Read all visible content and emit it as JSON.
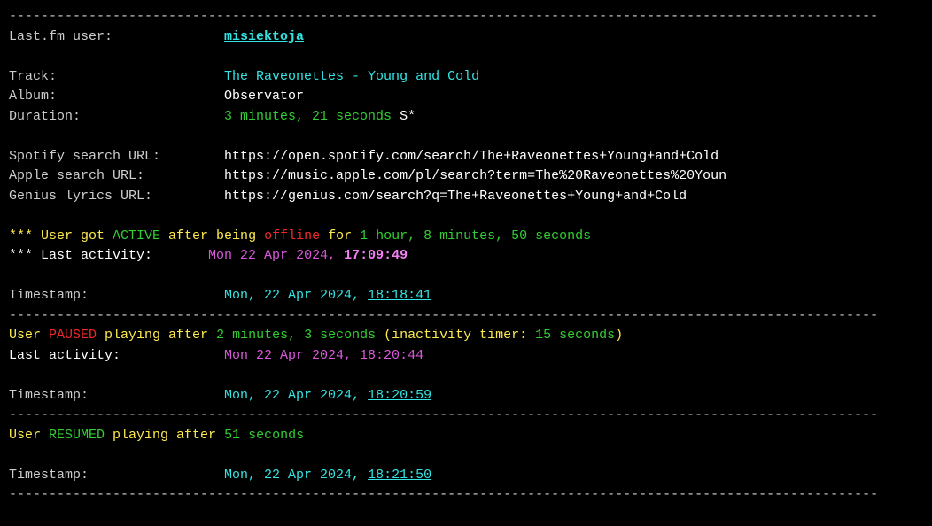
{
  "dash_line": "-------------------------------------------------------------------------------------------------------------",
  "labels": {
    "user": "Last.fm user:",
    "track": "Track:",
    "album": "Album:",
    "duration": "Duration:",
    "spotify": "Spotify search URL:",
    "apple": "Apple search URL:",
    "genius": "Genius lyrics URL:",
    "timestamp": "Timestamp:",
    "last_activity": "Last activity:"
  },
  "user": {
    "name": "misiektoja"
  },
  "track": {
    "title": "The Raveonettes - Young and Cold",
    "album": "Observator",
    "duration": "3 minutes, 21 seconds",
    "duration_suffix": " S*"
  },
  "urls": {
    "spotify": "https://open.spotify.com/search/The+Raveonettes+Young+and+Cold",
    "apple": "https://music.apple.com/pl/search?term=The%20Raveonettes%20Youn",
    "genius": "https://genius.com/search?q=The+Raveonettes+Young+and+Cold"
  },
  "event1": {
    "prefix": "*** ",
    "user_word": "User got ",
    "state": "ACTIVE",
    "after_being": " after being ",
    "offline": "offline",
    "for": " for ",
    "duration": "1 hour, 8 minutes, 50 seconds",
    "last_activity_prefix": "*** Last activity:       ",
    "last_activity_date": "Mon 22 Apr 2024, ",
    "last_activity_time": "17:09:49",
    "ts_date": "Mon, 22 Apr 2024, ",
    "ts_time": "18:18:41"
  },
  "event2": {
    "user_word": "User ",
    "state": "PAUSED",
    "playing_after": " playing after ",
    "duration": "2 minutes, 3 seconds",
    "inactivity_label": " (inactivity timer: ",
    "inactivity_value": "15 seconds",
    "close_paren": ")",
    "last_activity_date": "Mon 22 Apr 2024, 18:20:44",
    "ts_date": "Mon, 22 Apr 2024, ",
    "ts_time": "18:20:59"
  },
  "event3": {
    "user_word": "User ",
    "state": "RESUMED",
    "playing_after": " playing after ",
    "duration": "51 seconds",
    "ts_date": "Mon, 22 Apr 2024, ",
    "ts_time": "18:21:50"
  }
}
